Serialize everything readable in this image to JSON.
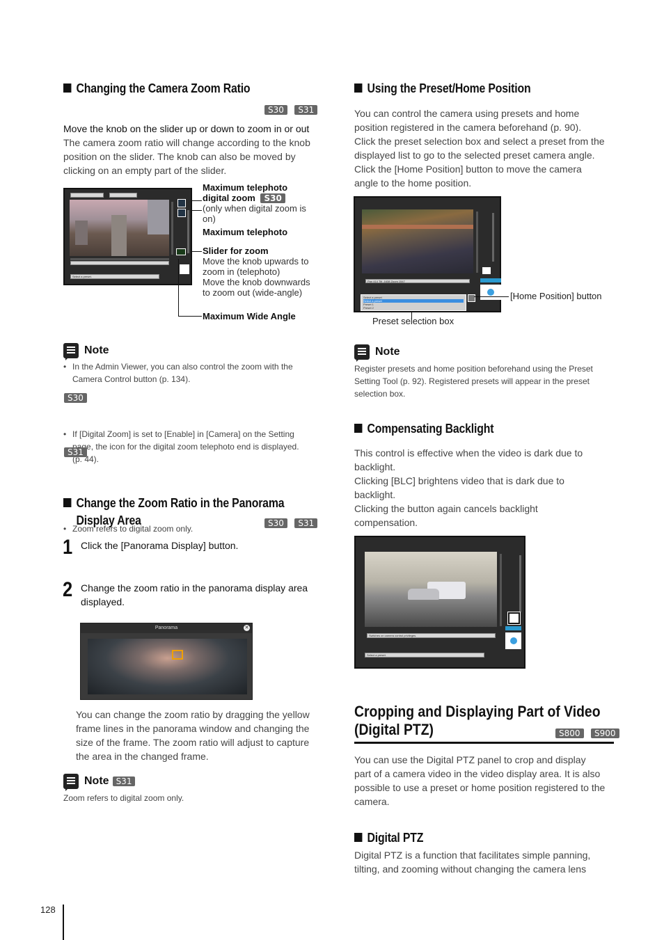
{
  "page_number": "128",
  "left": {
    "zoom_section": {
      "heading": "Changing the Camera Zoom Ratio",
      "badges": [
        "S30",
        "S31"
      ],
      "lead": "Move the knob on the slider up or down to zoom in or out",
      "body": [
        "The camera zoom ratio will change according to the knob",
        "position on the slider. The knob can also be moved by",
        "clicking on an empty part of the slider."
      ],
      "figure": {
        "callouts": [
          {
            "title_line1": "Maximum telephoto",
            "title_line2": "digital zoom",
            "badge": "S30",
            "desc": [
              "(only when digital zoom is",
              "on)"
            ]
          },
          {
            "title": "Maximum telephoto"
          },
          {
            "title": "Slider for zoom",
            "desc": [
              "Move the knob upwards to",
              "zoom in (telephoto)",
              "Move the knob downwards",
              "to zoom out (wide-angle)"
            ]
          },
          {
            "title": "Maximum Wide Angle"
          }
        ],
        "ui": {
          "preset_placeholder": "Select a preset."
        }
      }
    },
    "note1": {
      "title": "Note",
      "items": [
        "In the Admin Viewer, you can also control the zoom with the",
        "Camera Control button (p. 134)."
      ],
      "s30_badge": "S30",
      "s30_items": [
        "If [Digital Zoom] is set to [Enable] in [Camera] on the Setting",
        "page, the icon for the digital zoom telephoto end is displayed.",
        "(p. 44)."
      ],
      "s31_badge": "S31",
      "s31_items": [
        "Zoom refers to digital zoom only."
      ]
    },
    "panorama_section": {
      "heading_line1": "Change the Zoom Ratio in the Panorama",
      "heading_line2": "Display Area",
      "badges": [
        "S30",
        "S31"
      ],
      "steps": [
        {
          "num": "1",
          "text": [
            "Click the [Panorama Display] button."
          ]
        },
        {
          "num": "2",
          "text": [
            "Change the zoom ratio in the panorama display area",
            "displayed."
          ]
        }
      ],
      "panorama_window_title": "Panorama",
      "body": [
        "You can change the zoom ratio by dragging the yellow",
        "frame lines in the panorama window and changing the",
        "size of the frame. The zoom ratio will adjust to capture",
        "the area in the changed frame."
      ],
      "note": {
        "title": "Note",
        "badge": "S31",
        "text": "Zoom refers to digital zoom only."
      }
    }
  },
  "right": {
    "preset_section": {
      "heading": "Using the Preset/Home Position",
      "body": [
        "You can control the camera using presets and home",
        "position registered in the camera beforehand (p. 90).",
        "Click the preset selection box and select a preset from the",
        "displayed list to go to the selected preset camera angle.",
        "Click the [Home Position] button to move the camera",
        "angle to the home position."
      ],
      "figure": {
        "home_callout": "[Home Position] button",
        "preset_callout": "Preset selection box",
        "dropdown": {
          "selected": "Select a preset",
          "options": [
            "Select a preset",
            "Preset 1",
            "Preset 2"
          ]
        },
        "status": "Pan 414 Tilt -1638 Zoom 1547"
      }
    },
    "note": {
      "title": "Note",
      "text": [
        "Register presets and home position beforehand using the Preset",
        "Setting Tool (p. 92). Registered presets will appear in the preset",
        "selection box."
      ]
    },
    "backlight_section": {
      "heading": "Compensating Backlight",
      "body": [
        "This control is effective when the video is dark due to",
        "backlight.",
        "Clicking [BLC] brightens video that is dark due to",
        "backlight.",
        "Clicking the button again cancels backlight",
        "compensation."
      ],
      "figure": {
        "status": "Switches on camera control privileges.",
        "preset_placeholder": "Select a preset."
      }
    },
    "digital_ptz_chapter": {
      "heading_line1": "Cropping and Displaying Part of Video",
      "heading_line2": "(Digital PTZ)",
      "badges": [
        "S800",
        "S900"
      ],
      "body": [
        "You can use the Digital PTZ panel to crop and display",
        "part of a camera video in the video display area. It is also",
        "possible to use a preset or home position registered to the",
        "camera."
      ]
    },
    "digital_ptz_section": {
      "heading": "Digital PTZ",
      "body": [
        "Digital PTZ is a function that facilitates simple panning,",
        "tilting, and zooming without changing the camera lens"
      ]
    }
  }
}
